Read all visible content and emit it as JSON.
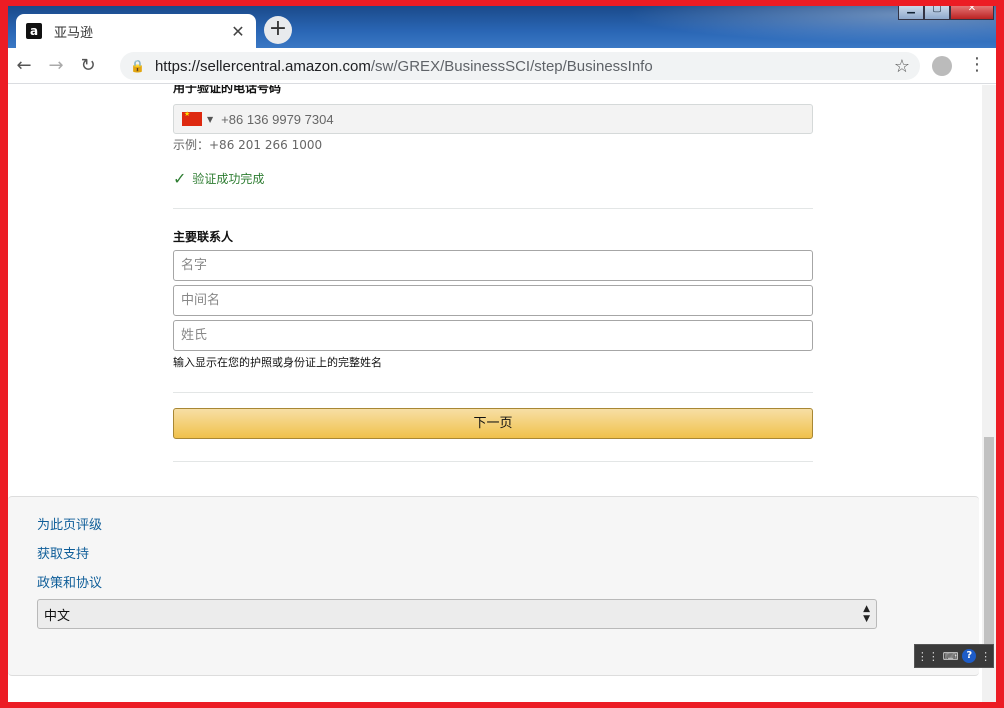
{
  "browser": {
    "tab_title": "亚马逊",
    "tab_favicon": "a",
    "url_host": "https://sellercentral.amazon.com",
    "url_path": "/sw/GREX/BusinessSCI/step/BusinessInfo"
  },
  "phone": {
    "label": "用于验证的电话号码",
    "country": "China",
    "value": "+86 136 9979 7304",
    "example": "示例：+86 201 266 1000",
    "verified": "验证成功完成"
  },
  "contact": {
    "label": "主要联系人",
    "first_name_placeholder": "名字",
    "middle_name_placeholder": "中间名",
    "last_name_placeholder": "姓氏",
    "hint": "输入显示在您的护照或身份证上的完整姓名"
  },
  "next_button": "下一页",
  "footer": {
    "rate_page": "为此页评级",
    "get_support": "获取支持",
    "policies": "政策和协议",
    "language_selected": "中文"
  },
  "colors": {
    "frame_border": "#ec1c24",
    "link": "#0f5e99",
    "verified": "#2e7d32",
    "button": "#f0c14b"
  }
}
